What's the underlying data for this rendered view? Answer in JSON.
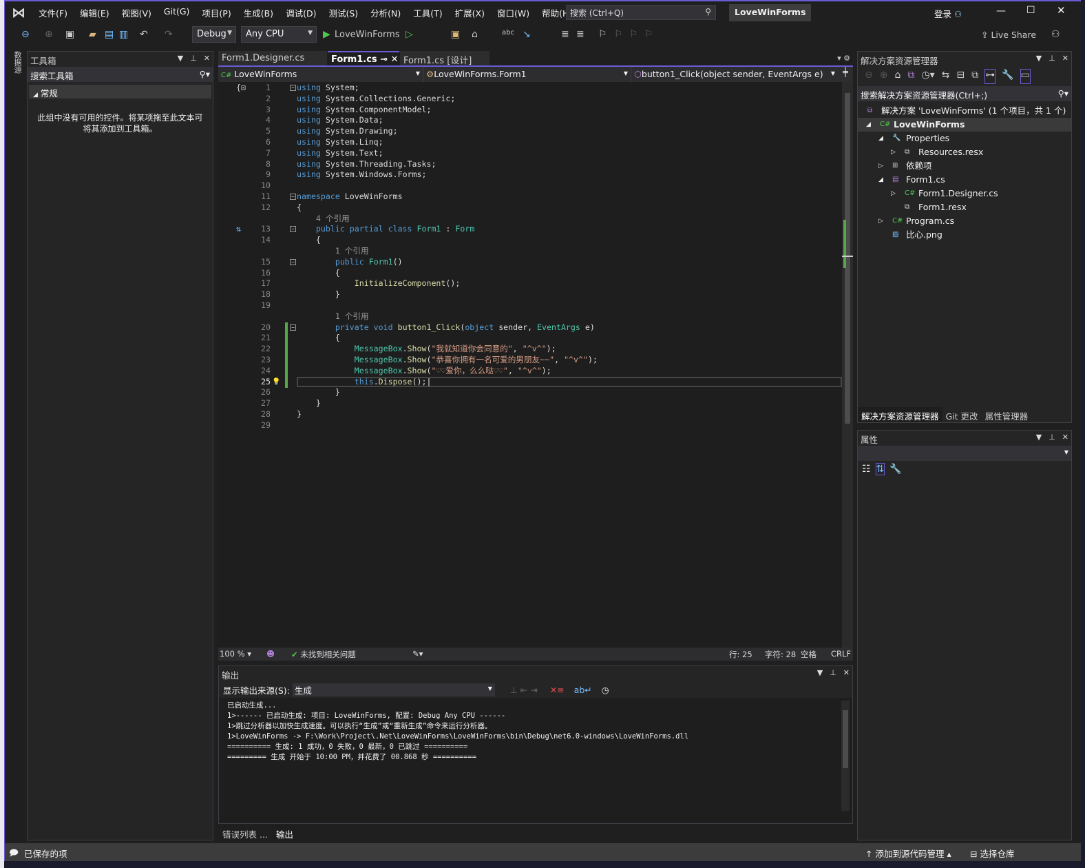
{
  "colors": {
    "accent": "#6a5cd6",
    "keyword": "#569cd6",
    "type": "#4ec9b0",
    "string": "#d69d85",
    "method": "#dcdcaa",
    "change_bar": "#57a64a"
  },
  "menu": [
    "文件(F)",
    "编辑(E)",
    "视图(V)",
    "Git(G)",
    "项目(P)",
    "生成(B)",
    "调试(D)",
    "测试(S)",
    "分析(N)",
    "工具(T)",
    "扩展(X)",
    "窗口(W)",
    "帮助(H)"
  ],
  "search": {
    "placeholder": "搜索 (Ctrl+Q)"
  },
  "project_title": "LoveWinForms",
  "account": {
    "login": "登录"
  },
  "toolbar": {
    "config": "Debug",
    "platform": "Any CPU",
    "start": "LoveWinForms",
    "live_share": "Live Share"
  },
  "left_strip": {
    "label": "数据源"
  },
  "toolbox": {
    "title": "工具箱",
    "search_placeholder": "搜索工具箱",
    "group": "常规",
    "empty_message_1": "此组中没有可用的控件。将某项拖至此文本可",
    "empty_message_2": "将其添加到工具箱。"
  },
  "editor": {
    "tabs": [
      {
        "label": "Form1.Designer.cs"
      },
      {
        "label": "Form1.cs",
        "active": true
      },
      {
        "label": "Form1.cs [设计]"
      }
    ],
    "nav": {
      "project": "LoveWinForms",
      "class": "LoveWinForms.Form1",
      "member": "button1_Click(object sender, EventArgs e)"
    },
    "current_line": 25,
    "lines": [
      {
        "n": 1,
        "tk": [
          [
            "k",
            "using"
          ],
          [
            "p",
            " System;"
          ]
        ]
      },
      {
        "n": 2,
        "tk": [
          [
            "k",
            "using"
          ],
          [
            "p",
            " System.Collections.Generic;"
          ]
        ]
      },
      {
        "n": 3,
        "tk": [
          [
            "k",
            "using"
          ],
          [
            "p",
            " System.ComponentModel;"
          ]
        ]
      },
      {
        "n": 4,
        "tk": [
          [
            "k",
            "using"
          ],
          [
            "p",
            " System.Data;"
          ]
        ]
      },
      {
        "n": 5,
        "tk": [
          [
            "k",
            "using"
          ],
          [
            "p",
            " System.Drawing;"
          ]
        ]
      },
      {
        "n": 6,
        "tk": [
          [
            "k",
            "using"
          ],
          [
            "p",
            " System.Linq;"
          ]
        ]
      },
      {
        "n": 7,
        "tk": [
          [
            "k",
            "using"
          ],
          [
            "p",
            " System.Text;"
          ]
        ]
      },
      {
        "n": 8,
        "tk": [
          [
            "k",
            "using"
          ],
          [
            "p",
            " System.Threading.Tasks;"
          ]
        ]
      },
      {
        "n": 9,
        "tk": [
          [
            "k",
            "using"
          ],
          [
            "p",
            " System.Windows.Forms;"
          ]
        ]
      },
      {
        "n": 10,
        "tk": []
      },
      {
        "n": 11,
        "tk": [
          [
            "k",
            "namespace"
          ],
          [
            "p",
            " LoveWinForms"
          ]
        ]
      },
      {
        "n": 12,
        "tk": [
          [
            "p",
            "{"
          ]
        ]
      },
      {
        "lens": "    4 个引用"
      },
      {
        "n": 13,
        "tk": [
          [
            "k",
            "    public partial class"
          ],
          [
            "p",
            " "
          ],
          [
            "t",
            "Form1"
          ],
          [
            "p",
            " : "
          ],
          [
            "t",
            "Form"
          ]
        ]
      },
      {
        "n": 14,
        "tk": [
          [
            "p",
            "    {"
          ]
        ]
      },
      {
        "lens": "        1 个引用"
      },
      {
        "n": 15,
        "tk": [
          [
            "k",
            "        public"
          ],
          [
            "p",
            " "
          ],
          [
            "t",
            "Form1"
          ],
          [
            "p",
            "()"
          ]
        ]
      },
      {
        "n": 16,
        "tk": [
          [
            "p",
            "        {"
          ]
        ]
      },
      {
        "n": 17,
        "tk": [
          [
            "m",
            "            InitializeComponent"
          ],
          [
            "p",
            "();"
          ]
        ]
      },
      {
        "n": 18,
        "tk": [
          [
            "p",
            "        }"
          ]
        ]
      },
      {
        "n": 19,
        "tk": []
      },
      {
        "lens": "        1 个引用"
      },
      {
        "n": 20,
        "tk": [
          [
            "k",
            "        private void"
          ],
          [
            "p",
            " "
          ],
          [
            "m",
            "button1_Click"
          ],
          [
            "p",
            "("
          ],
          [
            "k",
            "object"
          ],
          [
            "p",
            " sender, "
          ],
          [
            "t",
            "EventArgs"
          ],
          [
            "p",
            " e)"
          ]
        ]
      },
      {
        "n": 21,
        "tk": [
          [
            "p",
            "        {"
          ]
        ]
      },
      {
        "n": 22,
        "tk": [
          [
            "t",
            "            MessageBox"
          ],
          [
            "p",
            "."
          ],
          [
            "m",
            "Show"
          ],
          [
            "p",
            "("
          ],
          [
            "s",
            "\"我就知道你会同意的\""
          ],
          [
            "p",
            ", "
          ],
          [
            "s",
            "\"^v^\""
          ],
          [
            "p",
            ");"
          ]
        ]
      },
      {
        "n": 23,
        "tk": [
          [
            "t",
            "            MessageBox"
          ],
          [
            "p",
            "."
          ],
          [
            "m",
            "Show"
          ],
          [
            "p",
            "("
          ],
          [
            "s",
            "\"恭喜你拥有一名可爱的男朋友~~\""
          ],
          [
            "p",
            ", "
          ],
          [
            "s",
            "\"^v^\""
          ],
          [
            "p",
            ");"
          ]
        ]
      },
      {
        "n": 24,
        "tk": [
          [
            "t",
            "            MessageBox"
          ],
          [
            "p",
            "."
          ],
          [
            "m",
            "Show"
          ],
          [
            "p",
            "("
          ],
          [
            "s",
            "\"♡♡爱你，么么哒♡♡\""
          ],
          [
            "p",
            ", "
          ],
          [
            "s",
            "\"^v^\""
          ],
          [
            "p",
            ");"
          ]
        ]
      },
      {
        "n": 25,
        "tk": [
          [
            "k",
            "            this"
          ],
          [
            "p",
            "."
          ],
          [
            "m",
            "Dispose"
          ],
          [
            "p",
            "();"
          ]
        ]
      },
      {
        "n": 26,
        "tk": [
          [
            "p",
            "        }"
          ]
        ]
      },
      {
        "n": 27,
        "tk": [
          [
            "p",
            "    }"
          ]
        ]
      },
      {
        "n": 28,
        "tk": [
          [
            "p",
            "}"
          ]
        ]
      },
      {
        "n": 29,
        "tk": []
      }
    ],
    "status": {
      "zoom": "100 %",
      "issues": "未找到相关问题",
      "line": "行: 25",
      "char": "字符: 28",
      "whitespace": "空格",
      "eol": "CRLF"
    }
  },
  "output": {
    "title": "输出",
    "source_label": "显示输出来源(S):",
    "source_value": "生成",
    "lines": [
      "已启动生成...",
      "1>------ 已启动生成: 项目: LoveWinForms, 配置: Debug Any CPU ------",
      "1>跳过分析器以加快生成速度。可以执行“生成”或“重新生成”命令来运行分析器。",
      "1>LoveWinForms -> F:\\Work\\Project\\.Net\\LoveWinForms\\LoveWinForms\\bin\\Debug\\net6.0-windows\\LoveWinForms.dll",
      "========== 生成: 1 成功，0 失败，0 最新，0 已跳过 ==========",
      "========= 生成 开始于 10:00 PM，并花费了 00.868 秒 =========="
    ],
    "tabs": [
      {
        "label": "错误列表 ..."
      },
      {
        "label": "输出",
        "active": true
      }
    ]
  },
  "solution_explorer": {
    "title": "解决方案资源管理器",
    "search_placeholder": "搜索解决方案资源管理器(Ctrl+;)",
    "items": [
      {
        "label": "解决方案 'LoveWinForms' (1 个项目，共 1 个)",
        "depth": 0,
        "icon": "solution-icon",
        "exp": ""
      },
      {
        "label": "LoveWinForms",
        "depth": 0,
        "icon": "csharp-project-icon",
        "exp": "◢",
        "bold": true
      },
      {
        "label": "Properties",
        "depth": 1,
        "icon": "properties-icon",
        "exp": "◢"
      },
      {
        "label": "Resources.resx",
        "depth": 2,
        "icon": "resx-icon",
        "exp": "▷"
      },
      {
        "label": "依赖项",
        "depth": 1,
        "icon": "dependencies-icon",
        "exp": "▷"
      },
      {
        "label": "Form1.cs",
        "depth": 1,
        "icon": "form-icon",
        "exp": "◢"
      },
      {
        "label": "Form1.Designer.cs",
        "depth": 2,
        "icon": "csharp-file-icon",
        "exp": "▷"
      },
      {
        "label": "Form1.resx",
        "depth": 2,
        "icon": "resx-icon",
        "exp": ""
      },
      {
        "label": "Program.cs",
        "depth": 1,
        "icon": "csharp-file-icon",
        "exp": "▷"
      },
      {
        "label": "比心.png",
        "depth": 1,
        "icon": "image-icon",
        "exp": ""
      }
    ],
    "bottom_tabs": [
      {
        "label": "解决方案资源管理器",
        "active": true
      },
      {
        "label": "Git 更改"
      },
      {
        "label": "属性管理器"
      }
    ]
  },
  "properties": {
    "title": "属性"
  },
  "statusbar": {
    "saved": "已保存的项",
    "source_control": "添加到源代码管理",
    "repo": "选择仓库"
  }
}
